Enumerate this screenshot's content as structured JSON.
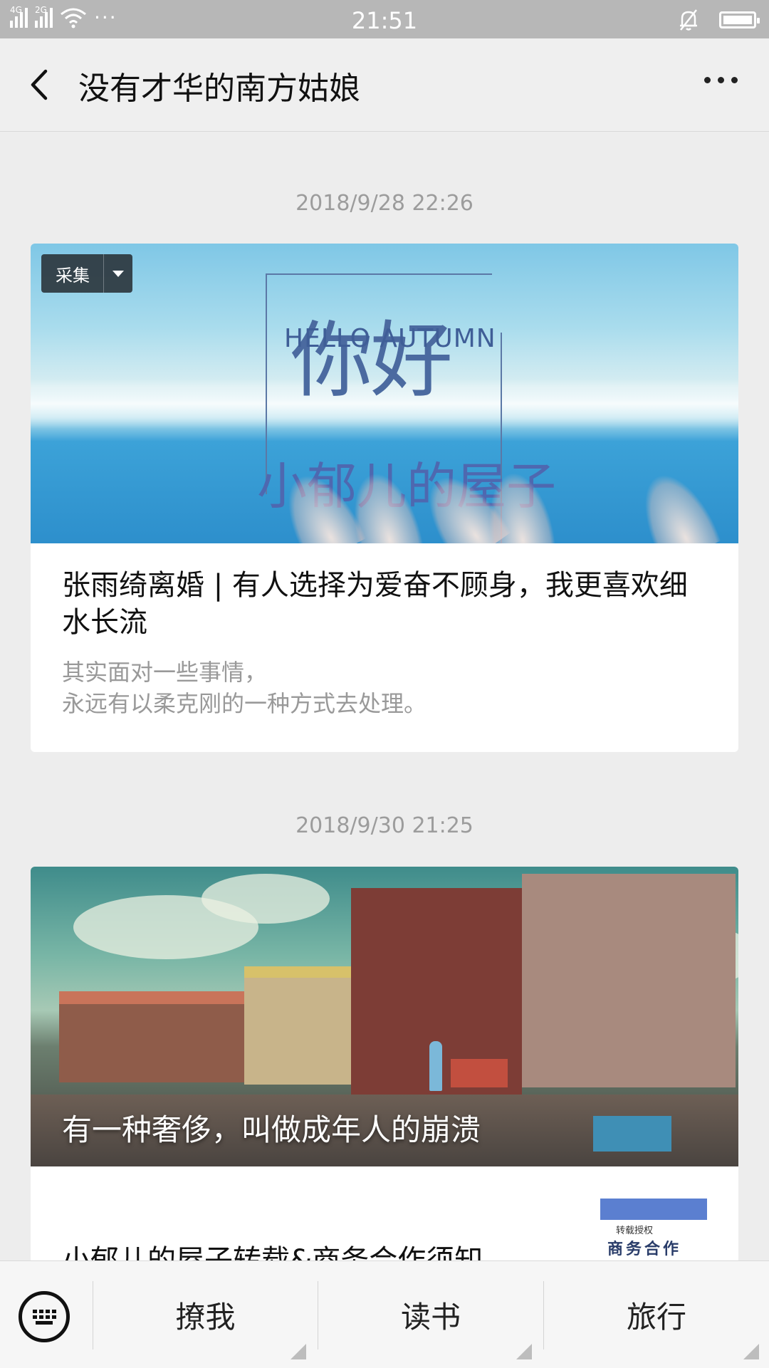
{
  "status_bar": {
    "network_left": "4G",
    "network_right": "2G",
    "time": "21:51",
    "icons": [
      "signal-icon",
      "wifi-icon",
      "more-dots-icon",
      "bell-muted-icon",
      "battery-icon"
    ]
  },
  "nav": {
    "title": "没有才华的南方姑娘",
    "back_icon": "chevron-left-icon",
    "more_icon": "more-icon"
  },
  "messages": [
    {
      "timestamp": "2018/9/28 22:26",
      "collect_label": "采集",
      "cover": {
        "hello_cn": "你好",
        "hello_en": "HELLO AUTUMN",
        "caption": "小郁儿的屋子"
      },
      "title": "张雨绮离婚 | 有人选择为爱奋不顾身，我更喜欢细水长流",
      "desc_line1": "其实面对一些事情，",
      "desc_line2": "永远有以柔克刚的一种方式去处理。"
    },
    {
      "timestamp": "2018/9/30 21:25",
      "cover_title": "有一种奢侈，叫做成年人的崩溃",
      "sub_title": "小郁儿的屋子转载&商务合作须知",
      "thumb_small": "转载授权",
      "thumb_big": "商务合作"
    }
  ],
  "bottom_menu": {
    "keyboard_icon": "keyboard-icon",
    "items": [
      "撩我",
      "读书",
      "旅行"
    ]
  },
  "colors": {
    "background": "#ededed",
    "timestamp": "#9c9c9c",
    "desc": "#999999"
  }
}
